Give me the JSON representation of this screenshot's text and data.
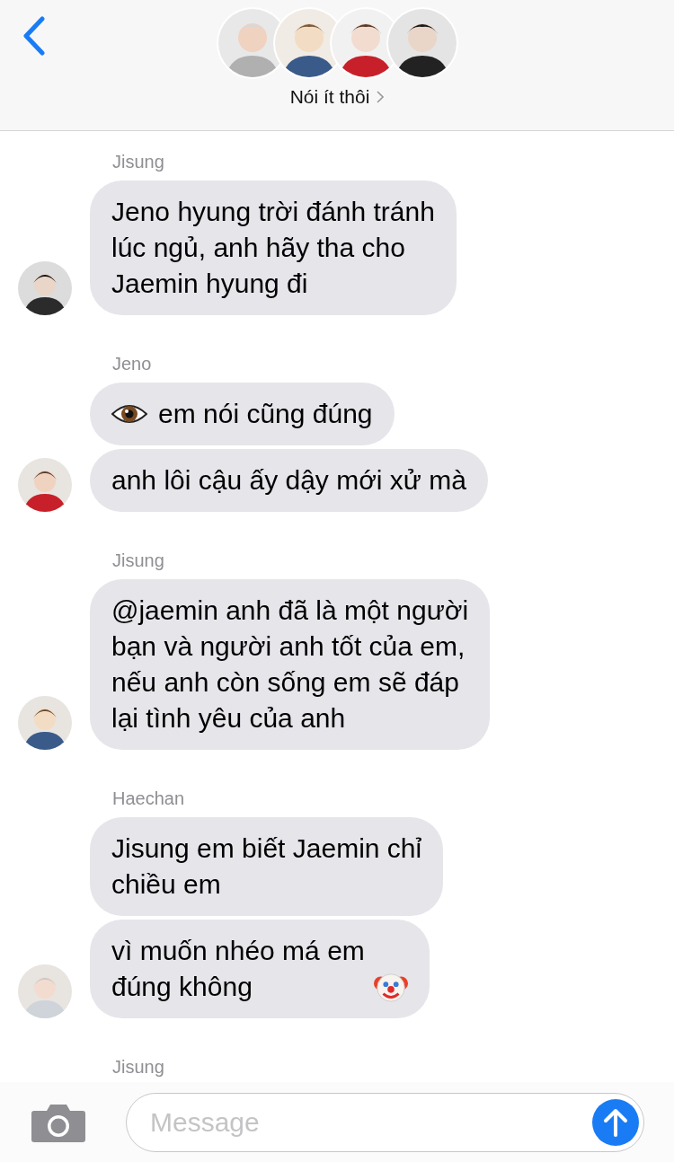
{
  "header": {
    "title": "Nói ít thôi"
  },
  "groups": [
    {
      "sender": "Jisung",
      "messages": [
        {
          "kind": "plain",
          "text": "Jeno hyung trời đánh tránh\nlúc ngủ, anh hãy tha cho\nJaemin hyung đi"
        }
      ]
    },
    {
      "sender": "Jeno",
      "messages": [
        {
          "kind": "eye",
          "text": "em nói cũng đúng"
        },
        {
          "kind": "plain",
          "text": "anh lôi cậu ấy dậy mới xử mà"
        }
      ]
    },
    {
      "sender": "Jisung",
      "messages": [
        {
          "kind": "plain",
          "text": "@jaemin anh đã là một người\nbạn và người anh tốt của em,\nnếu anh còn sống em sẽ đáp\nlại tình yêu của anh"
        }
      ]
    },
    {
      "sender": "Haechan",
      "messages": [
        {
          "kind": "plain",
          "text": "Jisung em biết Jaemin chỉ\nchiều em"
        },
        {
          "kind": "clown",
          "text": "vì muốn nhéo má em\nđúng không"
        }
      ]
    },
    {
      "sender": "Jisung"
    }
  ],
  "composer": {
    "placeholder": "Message"
  }
}
